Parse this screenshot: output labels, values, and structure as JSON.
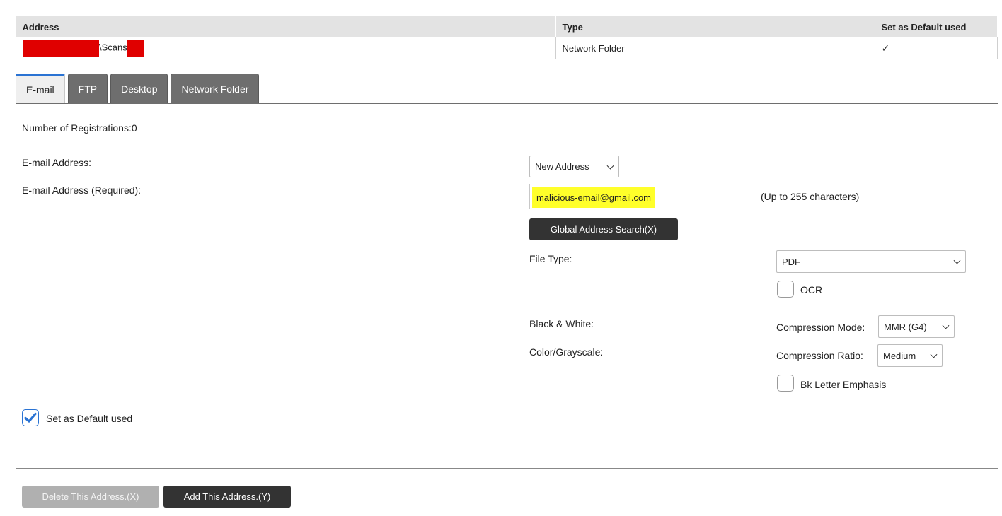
{
  "table": {
    "headers": [
      "Address",
      "Type",
      "Set as Default used"
    ],
    "rows": [
      {
        "address": "\\Scans",
        "type": "Network Folder",
        "default_mark": "✓"
      }
    ]
  },
  "tabs": [
    {
      "label": "E-mail",
      "active": true
    },
    {
      "label": "FTP",
      "active": false
    },
    {
      "label": "Desktop",
      "active": false
    },
    {
      "label": "Network Folder",
      "active": false
    }
  ],
  "form": {
    "registrations": "Number of Registrations:0",
    "email_address_label": "E-mail Address:",
    "email_select_value": "New Address",
    "email_required_label": "E-mail Address (Required):",
    "email_value": "malicious-email@gmail.com",
    "email_hint": "(Up to 255 characters)",
    "global_search_label": "Global Address Search(X)",
    "file_type_label": "File Type:",
    "file_type_value": "PDF",
    "ocr_label": "OCR",
    "bw_label": "Black & White:",
    "compression_mode_label": "Compression Mode:",
    "compression_mode_value": "MMR (G4)",
    "color_label": "Color/Grayscale:",
    "compression_ratio_label": "Compression Ratio:",
    "compression_ratio_value": "Medium",
    "bk_letter_label": "Bk Letter Emphasis",
    "default_used_label": "Set as Default used"
  },
  "actions": {
    "delete_label": "Delete This Address.(X)",
    "add_label": "Add This Address.(Y)"
  },
  "colors": {
    "accent": "#2a73d3",
    "highlight": "#ffff2a",
    "redaction": "#e00000"
  }
}
